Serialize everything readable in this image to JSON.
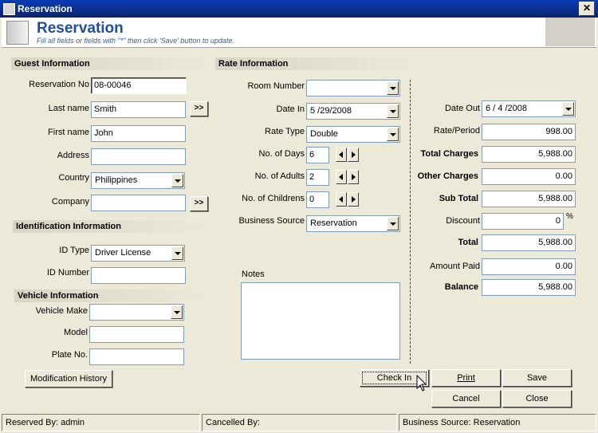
{
  "window": {
    "title": "Reservation",
    "close_glyph": "✕"
  },
  "header": {
    "title": "Reservation",
    "subtitle": "Fill all fields or fields with \"*\" then click 'Save' button to update."
  },
  "guest": {
    "section": "Guest Information",
    "reservation_no_label": "Reservation No",
    "reservation_no": "08-00046",
    "last_name_label": "Last name",
    "last_name": "Smith",
    "first_name_label": "First name",
    "first_name": "John",
    "address_label": "Address",
    "address": "",
    "country_label": "Country",
    "country": "Philippines",
    "company_label": "Company",
    "company": "",
    "browse_label": ">>"
  },
  "identification": {
    "section": "Identification Information",
    "id_type_label": "ID Type",
    "id_type": "Driver License",
    "id_number_label": "ID Number",
    "id_number": ""
  },
  "vehicle": {
    "section": "Vehicle Information",
    "make_label": "Vehicle Make",
    "make": "",
    "model_label": "Model",
    "model": "",
    "plate_label": "Plate No.",
    "plate": ""
  },
  "rate": {
    "section": "Rate Information",
    "room_number_label": "Room Number",
    "room_number": "",
    "date_in_label": "Date In",
    "date_in": "5 /29/2008",
    "rate_type_label": "Rate Type",
    "rate_type": "Double",
    "days_label": "No. of Days",
    "days": "6",
    "adults_label": "No. of Adults",
    "adults": "2",
    "children_label": "No. of Childrens",
    "children": "0",
    "business_source_label": "Business Source",
    "business_source": "Reservation",
    "notes_label": "Notes",
    "notes": ""
  },
  "charges": {
    "date_out_label": "Date Out",
    "date_out": "6 / 4 /2008",
    "rate_period_label": "Rate/Period",
    "rate_period": "998.00",
    "total_charges_label": "Total Charges",
    "total_charges": "5,988.00",
    "other_charges_label": "Other Charges",
    "other_charges": "0.00",
    "sub_total_label": "Sub Total",
    "sub_total": "5,988.00",
    "discount_label": "Discount",
    "discount": "0",
    "discount_unit": "%",
    "total_label": "Total",
    "total": "5,988.00",
    "amount_paid_label": "Amount Paid",
    "amount_paid": "0.00",
    "balance_label": "Balance",
    "balance": "5,988.00"
  },
  "buttons": {
    "modification_history": "Modification History",
    "check_in": "Check In",
    "print": "Print",
    "save": "Save",
    "cancel": "Cancel",
    "close": "Close"
  },
  "status": {
    "reserved_by": "Reserved By: admin",
    "cancelled_by": "Cancelled By:",
    "business_source": "Business Source: Reservation"
  }
}
